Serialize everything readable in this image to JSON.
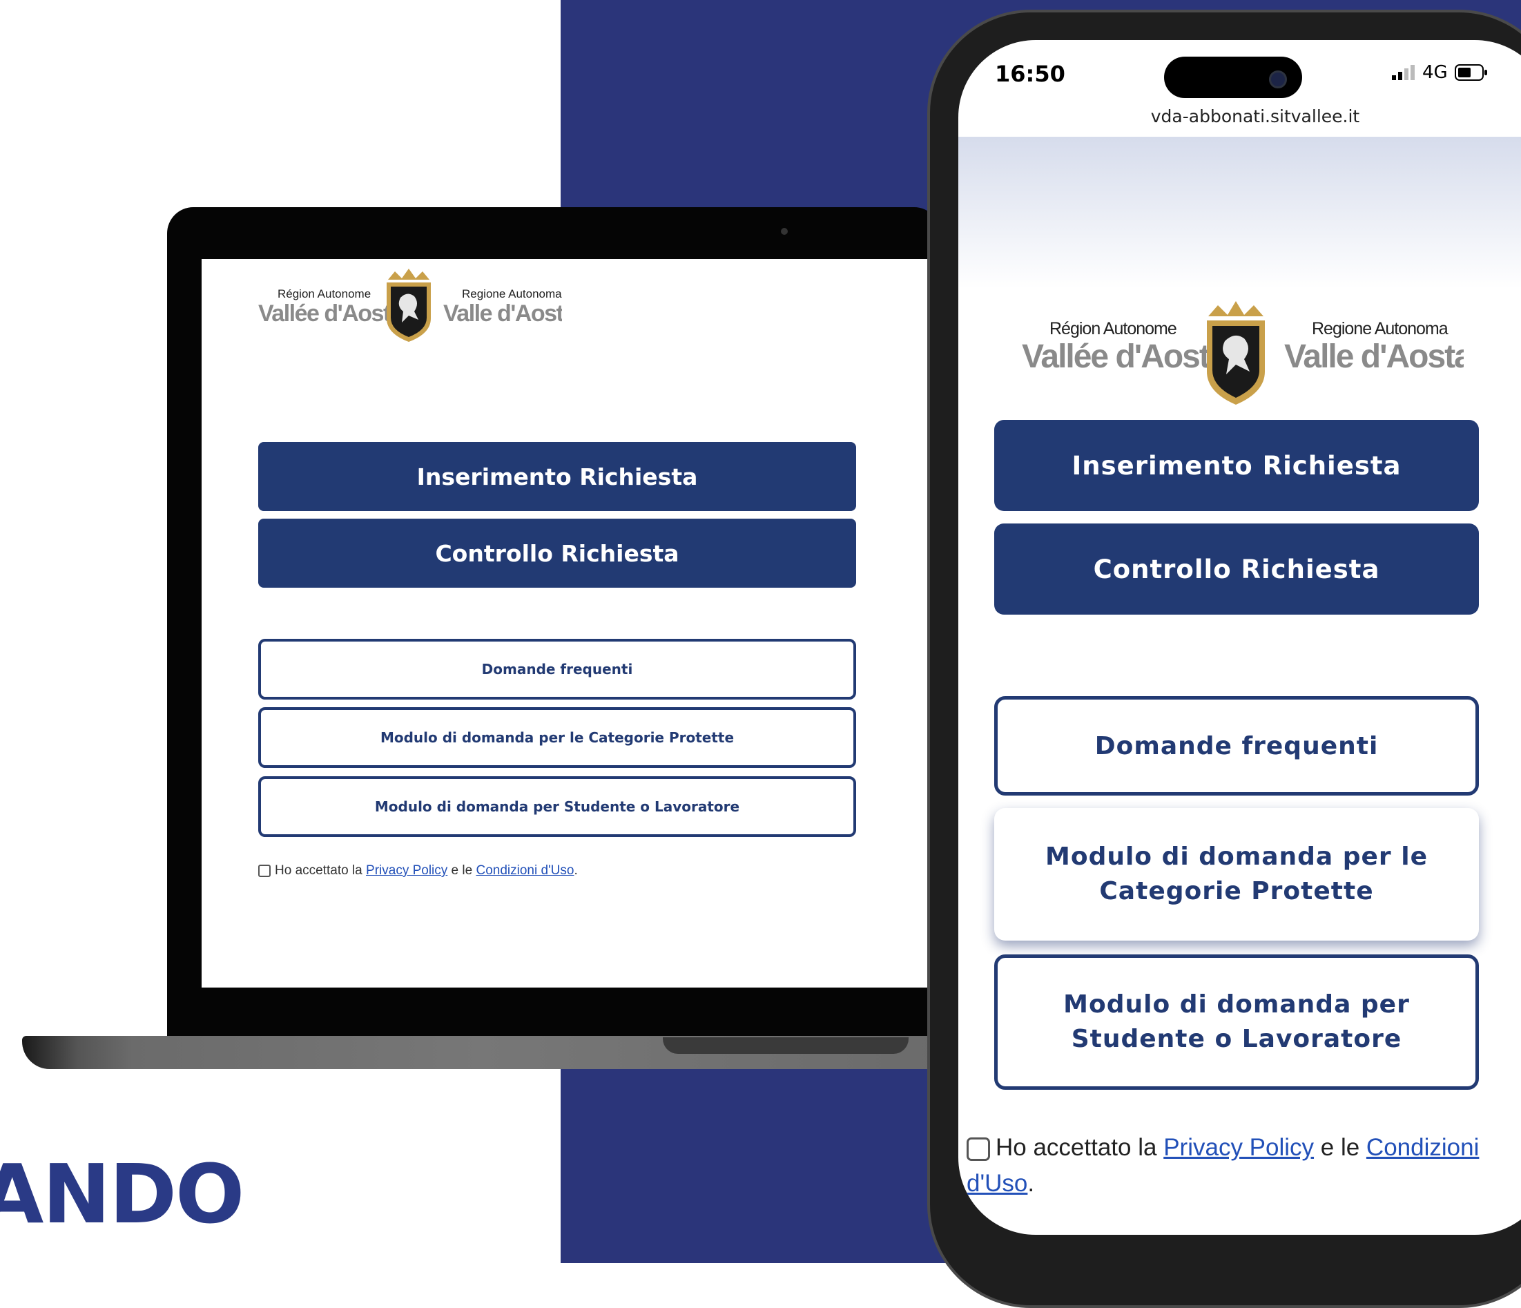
{
  "hero": {
    "word": "ANDO"
  },
  "laptop": {
    "logo": {
      "fr_top": "Région Autonome",
      "fr_bottom": "Vallée d'Aoste",
      "it_top": "Regione Autonoma",
      "it_bottom": "Valle d'Aosta"
    },
    "buttons": {
      "insert": "Inserimento Richiesta",
      "check": "Controllo Richiesta",
      "faq": "Domande frequenti",
      "protected": "Modulo di domanda per le Categorie Protette",
      "student": "Modulo di domanda per Studente o Lavoratore"
    },
    "consent": {
      "prefix": "Ho accettato la ",
      "privacy": "Privacy Policy",
      "middle": " e le ",
      "terms": "Condizioni d'Uso",
      "suffix": "."
    }
  },
  "phone": {
    "status": {
      "time": "16:50",
      "network": "4G"
    },
    "url": "vda-abbonati.sitvallee.it",
    "logo": {
      "fr_top": "Région Autonome",
      "fr_bottom": "Vallée d'Aoste",
      "it_top": "Regione Autonoma",
      "it_bottom": "Valle d'Aosta"
    },
    "buttons": {
      "insert": "Inserimento Richiesta",
      "check": "Controllo Richiesta",
      "faq": "Domande frequenti",
      "protected_line1": "Modulo di domanda per le",
      "protected_line2": "Categorie Protette",
      "student_line1": "Modulo di domanda per",
      "student_line2": "Studente o Lavoratore"
    },
    "consent": {
      "prefix": "Ho accettato la ",
      "privacy": "Privacy Policy",
      "middle": " e le ",
      "terms_1": "Condizioni",
      "terms_2": "d'Uso",
      "suffix": "."
    }
  },
  "colors": {
    "navy": "#2b357a",
    "button": "#223a73",
    "link": "#2250b8"
  }
}
